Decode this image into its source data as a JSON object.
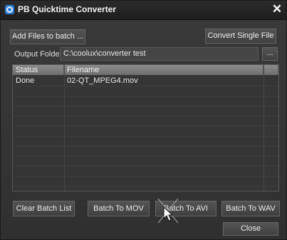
{
  "window": {
    "title": "PB Quicktime Converter",
    "close_glyph": "✕"
  },
  "toolbar": {
    "add_files_label": "Add Files to batch ...",
    "convert_single_label": "Convert Single File"
  },
  "output": {
    "label": "Output Folder",
    "path": "C:\\coolux\\converter test",
    "browse_label": "..."
  },
  "table": {
    "columns": [
      "Status",
      "Filename"
    ],
    "rows": [
      {
        "status": "Done",
        "filename": "02-QT_MPEG4.mov"
      }
    ]
  },
  "actions": {
    "clear_label": "Clear Batch List",
    "mov_label": "Batch To MOV",
    "avi_label": "Batch To AVI",
    "wav_label": "Batch To WAV",
    "close_label": "Close"
  },
  "colors": {
    "accent": "#2d7fd6",
    "header": "#7d7d7d"
  }
}
